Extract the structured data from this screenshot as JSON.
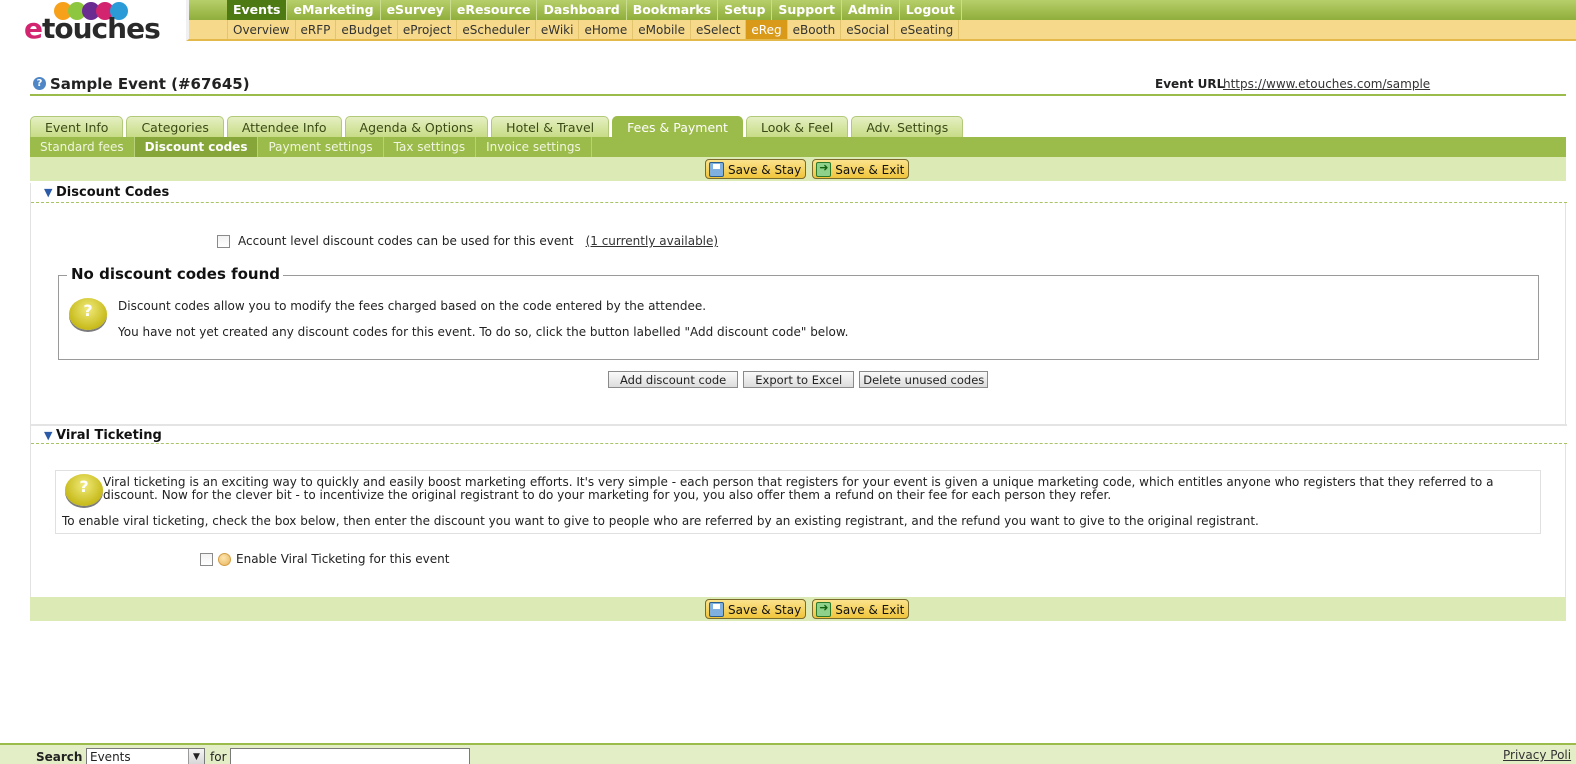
{
  "logo": {
    "first": "e",
    "rest": "touches",
    "blob_colors": [
      "#f7a11a",
      "#8dc63f",
      "#6a2c91",
      "#d3246f",
      "#2b9bd8"
    ]
  },
  "topnav": [
    "Events",
    "eMarketing",
    "eSurvey",
    "eResource",
    "Dashboard",
    "Bookmarks",
    "Setup",
    "Support",
    "Admin",
    "Logout"
  ],
  "subnav": [
    "Overview",
    "eRFP",
    "eBudget",
    "eProject",
    "eScheduler",
    "eWiki",
    "eHome",
    "eMobile",
    "eSelect",
    "eReg",
    "eBooth",
    "eSocial",
    "eSeating"
  ],
  "event": {
    "title": "Sample Event (#67645)",
    "url_label": "Event URL",
    "url": "https://www.etouches.com/sample"
  },
  "tabs": [
    "Event Info",
    "Categories",
    "Attendee Info",
    "Agenda & Options",
    "Hotel & Travel",
    "Fees & Payment",
    "Look & Feel",
    "Adv. Settings"
  ],
  "subtabs": [
    "Standard fees",
    "Discount codes",
    "Payment settings",
    "Tax settings",
    "Invoice settings"
  ],
  "save": {
    "stay": "Save & Stay",
    "exit": "Save & Exit"
  },
  "discount": {
    "heading": "Discount Codes",
    "account_label": "Account level discount codes can be used for this event",
    "account_link": "(1 currently available)",
    "box_title": "No discount codes found",
    "p1": "Discount codes allow you to modify the fees charged based on the code entered by the attendee.",
    "p2": "You have not yet created any discount codes for this event. To do so, click the button labelled \"Add discount code\" below.",
    "btn_add": "Add discount code",
    "btn_export": "Export to Excel",
    "btn_delete": "Delete unused codes"
  },
  "viral": {
    "heading": "Viral Ticketing",
    "p1": "Viral ticketing is an exciting way to quickly and easily boost marketing efforts. It's very simple - each person that registers for your event is given a unique marketing code, which entitles anyone who registers that they referred to a discount. Now for the clever bit - to incentivize the original registrant to do your marketing for you, you also offer them a refund on their fee for each person they refer.",
    "p2": "To enable viral ticketing, check the box below, then enter the discount you want to give to people who are referred by an existing registrant, and the refund you want to give to the original registrant.",
    "enable_label": "Enable Viral Ticketing for this event"
  },
  "footer": {
    "search_label": "Search",
    "search_scope": "Events",
    "for_label": "for",
    "privacy": "Privacy Poli"
  }
}
